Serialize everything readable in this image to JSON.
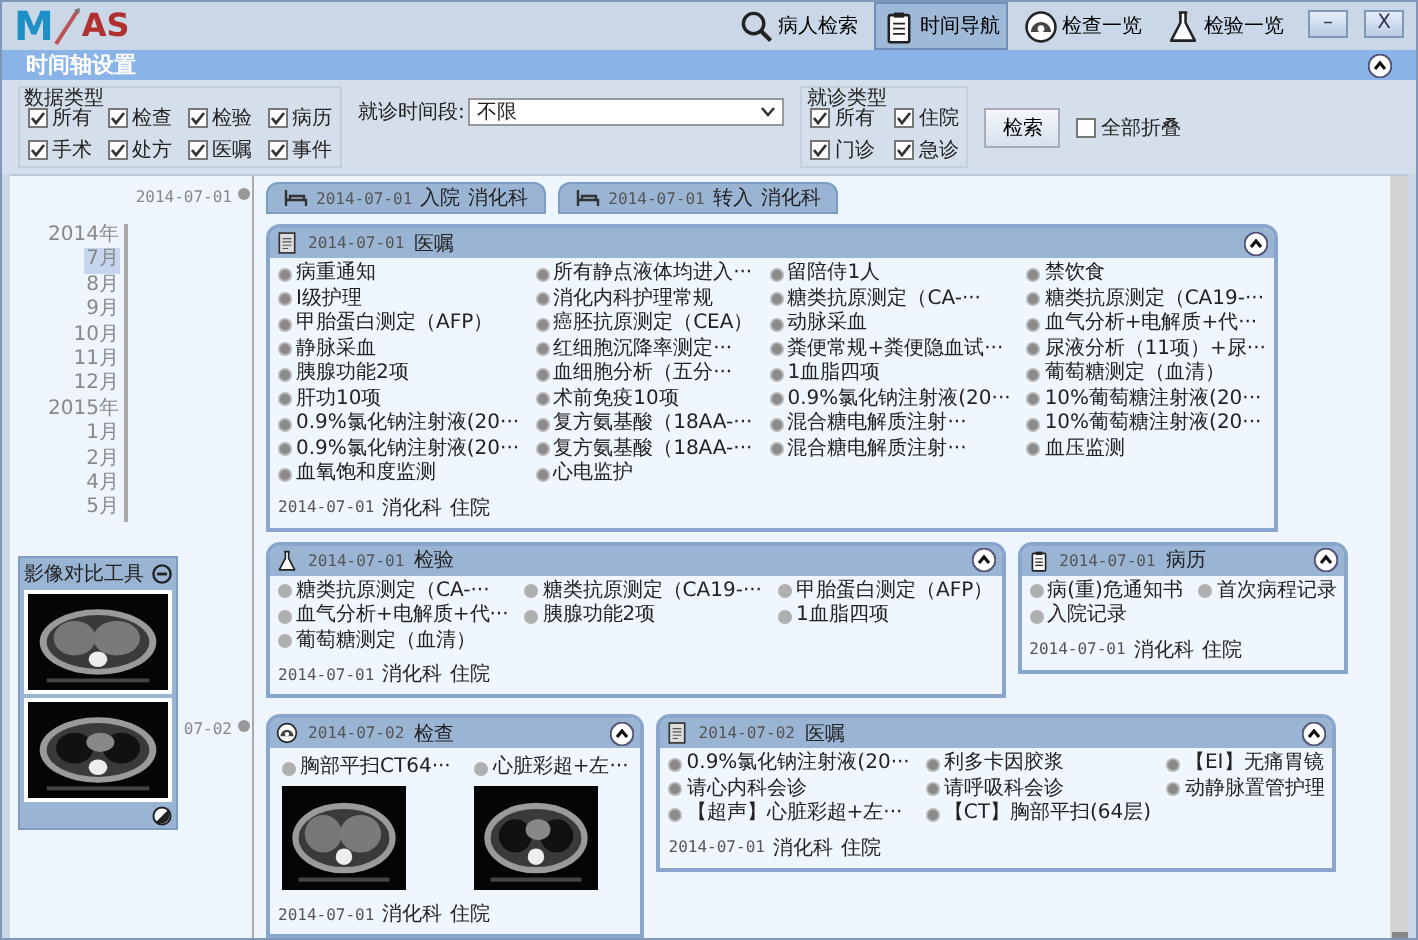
{
  "logo": {
    "left": "M",
    "right": "AS"
  },
  "nav": [
    {
      "label": "病人检索",
      "kind": "search",
      "selected": false
    },
    {
      "label": "时间导航",
      "kind": "clipboard",
      "selected": true
    },
    {
      "label": "检查一览",
      "kind": "scanner",
      "selected": false
    },
    {
      "label": "检验一览",
      "kind": "flask",
      "selected": false
    }
  ],
  "window_controls": [
    "–",
    "X"
  ],
  "section": {
    "title": "时间轴设置"
  },
  "filters": {
    "data_type_group": "数据类型",
    "data_types": [
      {
        "label": "所有",
        "checked": true
      },
      {
        "label": "检查",
        "checked": true
      },
      {
        "label": "检验",
        "checked": true
      },
      {
        "label": "病历",
        "checked": true
      },
      {
        "label": "手术",
        "checked": true
      },
      {
        "label": "处方",
        "checked": true
      },
      {
        "label": "医嘱",
        "checked": true
      },
      {
        "label": "事件",
        "checked": true
      }
    ],
    "period_label": "就诊时间段:",
    "period_value": "不限",
    "visit_type_group": "就诊类型",
    "visit_types": [
      {
        "label": "所有",
        "checked": true
      },
      {
        "label": "住院",
        "checked": true
      },
      {
        "label": "门诊",
        "checked": true
      },
      {
        "label": "急诊",
        "checked": true
      }
    ],
    "search_button": "检索",
    "collapse_all": {
      "label": "全部折叠",
      "checked": false
    }
  },
  "navigator": [
    {
      "label": "2014年",
      "selected": false
    },
    {
      "label": "7月",
      "selected": true
    },
    {
      "label": "8月",
      "selected": false
    },
    {
      "label": "9月",
      "selected": false
    },
    {
      "label": "10月",
      "selected": false
    },
    {
      "label": "11月",
      "selected": false
    },
    {
      "label": "12月",
      "selected": false
    },
    {
      "label": "2015年",
      "selected": false
    },
    {
      "label": "1月",
      "selected": false
    },
    {
      "label": "2月",
      "selected": false
    },
    {
      "label": "4月",
      "selected": false
    },
    {
      "label": "5月",
      "selected": false
    }
  ],
  "image_tool": {
    "title": "影像对比工具"
  },
  "days": [
    {
      "date": "2014-07-01",
      "events": [
        {
          "date": "2014-07-01",
          "title": "入院",
          "dept": "消化科"
        },
        {
          "date": "2014-07-01",
          "title": "转入",
          "dept": "消化科"
        }
      ],
      "cards": [
        {
          "kind": "order",
          "date": "2014-07-01",
          "title": "医嘱",
          "items": [
            "病重通知",
            "所有静点液体均进入···",
            "留陪侍1人",
            "禁饮食",
            "I级护理",
            "消化内科护理常规",
            "糖类抗原测定（CA-···",
            "糖类抗原测定（CA19-···",
            "甲胎蛋白测定（AFP）",
            "癌胚抗原测定（CEA）",
            "动脉采血",
            "血气分析+电解质+代···",
            "静脉采血",
            "红细胞沉降率测定···",
            "粪便常规+粪便隐血试···",
            "尿液分析（11项）+尿···",
            "胰腺功能2项",
            "血细胞分析（五分···",
            "1血脂四项",
            "葡萄糖测定（血清）",
            "肝功10项",
            "术前免疫10项",
            "0.9%氯化钠注射液(20···",
            "10%葡萄糖注射液(20···",
            "0.9%氯化钠注射液(20···",
            "复方氨基酸（18AA-···",
            "混合糖电解质注射···",
            "10%葡萄糖注射液(20···",
            "0.9%氯化钠注射液(20···",
            "复方氨基酸（18AA-···",
            "混合糖电解质注射···",
            "血压监测",
            "血氧饱和度监测",
            "心电监护"
          ],
          "footer": [
            "2014-07-01",
            "消化科",
            "住院"
          ]
        },
        {
          "kind": "lab",
          "date": "2014-07-01",
          "title": "检验",
          "items": [
            "糖类抗原测定（CA-···",
            "糖类抗原测定（CA19-···",
            "甲胎蛋白测定（AFP）",
            "血气分析+电解质+代···",
            "胰腺功能2项",
            "1血脂四项",
            "葡萄糖测定（血清）"
          ],
          "footer": [
            "2014-07-01",
            "消化科",
            "住院"
          ]
        },
        {
          "kind": "record",
          "date": "2014-07-01",
          "title": "病历",
          "items": [
            "病(重)危通知书",
            "首次病程记录",
            "入院记录"
          ],
          "footer": [
            "2014-07-01",
            "消化科",
            "住院"
          ]
        }
      ]
    },
    {
      "date": "07-02",
      "cards": [
        {
          "kind": "exam",
          "date": "2014-07-02",
          "title": "检查",
          "items": [
            "胸部平扫CT64···",
            "心脏彩超+左···"
          ],
          "footer": [
            "2014-07-01",
            "消化科",
            "住院"
          ]
        },
        {
          "kind": "order",
          "date": "2014-07-02",
          "title": "医嘱",
          "items": [
            "0.9%氯化钠注射液(20···",
            "利多卡因胶浆",
            "【EI】无痛胃镜",
            "请心内科会诊",
            "请呼吸科会诊",
            "动静脉置管护理",
            "【超声】心脏彩超+左···",
            "【CT】胸部平扫(64层)"
          ],
          "footer": [
            "2014-07-01",
            "消化科",
            "住院"
          ]
        }
      ]
    }
  ]
}
